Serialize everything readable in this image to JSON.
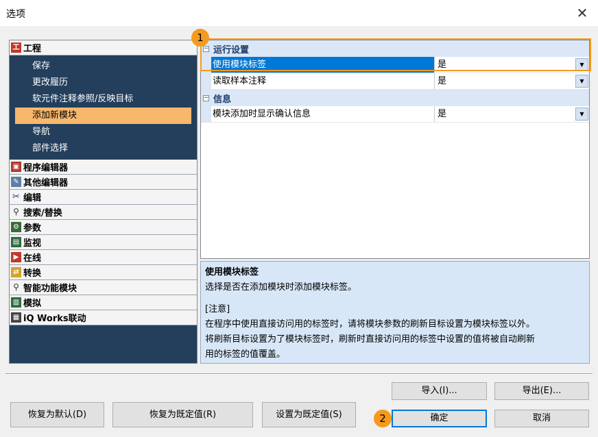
{
  "window": {
    "title": "选项",
    "close_glyph": "✕"
  },
  "tree": {
    "open_category": {
      "label": "工程",
      "icon": "project-icon"
    },
    "sub_items": [
      {
        "label": "保存",
        "selected": false
      },
      {
        "label": "更改履历",
        "selected": false
      },
      {
        "label": "软元件注释参照/反映目标",
        "selected": false
      },
      {
        "label": "添加新模块",
        "selected": true
      },
      {
        "label": "导航",
        "selected": false
      },
      {
        "label": "部件选择",
        "selected": false
      }
    ],
    "categories": [
      {
        "label": "程序编辑器",
        "icon": "program-editor-icon"
      },
      {
        "label": "其他编辑器",
        "icon": "other-editor-icon"
      },
      {
        "label": "编辑",
        "icon": "scissors-icon"
      },
      {
        "label": "搜索/替换",
        "icon": "binoculars-icon"
      },
      {
        "label": "参数",
        "icon": "parameter-icon"
      },
      {
        "label": "监视",
        "icon": "monitor-icon"
      },
      {
        "label": "在线",
        "icon": "online-icon"
      },
      {
        "label": "转换",
        "icon": "convert-icon"
      },
      {
        "label": "智能功能模块",
        "icon": "intelligent-module-icon"
      },
      {
        "label": "模拟",
        "icon": "simulation-icon"
      },
      {
        "label": "iQ Works联动",
        "icon": "iq-works-icon"
      }
    ]
  },
  "grid": {
    "groups": [
      {
        "label": "运行设置",
        "toggle": "⊟",
        "rows": [
          {
            "name": "使用模块标签",
            "value": "是",
            "selected": true
          },
          {
            "name": "读取样本注释",
            "value": "是",
            "selected": false
          }
        ]
      },
      {
        "label": "信息",
        "toggle": "⊟",
        "rows": [
          {
            "name": "模块添加时显示确认信息",
            "value": "是",
            "selected": false
          }
        ]
      }
    ]
  },
  "description": {
    "title": "使用模块标签",
    "line1": "选择是否在添加模块时添加模块标签。",
    "note_label": "[注意]",
    "note_line1": "在程序中使用直接访问用的标签时，请将模块参数的刷新目标设置为模块标签以外。",
    "note_line2": "将刷新目标设置为了模块标签时，刷新时直接访问用的标签中设置的值将被自动刷新",
    "note_line3": "用的标签的值覆盖。"
  },
  "buttons": {
    "import": "导入(I)...",
    "export": "导出(E)...",
    "restore_default": "恢复为默认(D)",
    "restore_preset": "恢复为既定值(R)",
    "set_preset": "设置为既定值(S)",
    "ok": "确定",
    "cancel": "取消"
  },
  "annotations": {
    "badge1": "1",
    "badge2": "2",
    "accent": "#f49a1e"
  },
  "colors": {
    "tree_bg": "#233f5c",
    "selected_item": "#f7b86c",
    "selected_prop": "#0078d7",
    "desc_bg": "#d8e7f8"
  }
}
